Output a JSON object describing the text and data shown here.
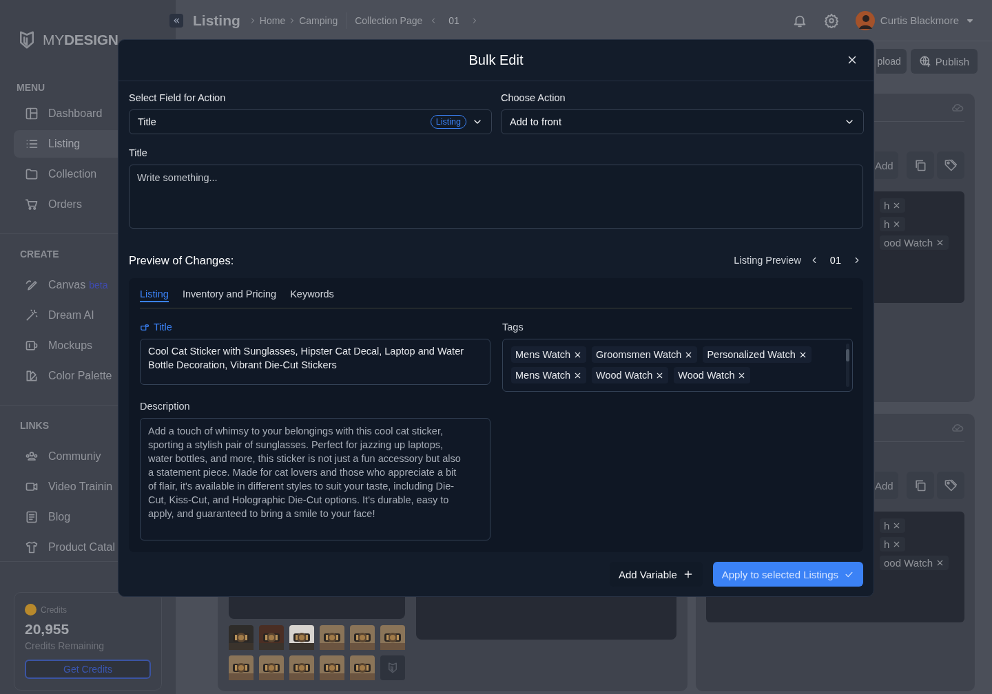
{
  "sidebar": {
    "logo": "MY**DESIGN**",
    "sections": [
      {
        "heading": "MENU",
        "items": [
          {
            "label": "Dashboard",
            "selected": false
          },
          {
            "label": "Listing",
            "selected": true
          },
          {
            "label": "Collection",
            "selected": false
          },
          {
            "label": "Orders",
            "selected": false
          }
        ]
      },
      {
        "heading": "CREATE",
        "items": [
          {
            "label": "Canvas",
            "badge": "beta",
            "selected": false
          },
          {
            "label": "Dream AI",
            "selected": false
          },
          {
            "label": "Mockups",
            "selected": false
          },
          {
            "label": "Color Palette",
            "selected": false
          }
        ]
      },
      {
        "heading": "LINKS",
        "items": [
          {
            "label": "Communiy",
            "selected": false
          },
          {
            "label": "Video Trainin",
            "selected": false
          },
          {
            "label": "Blog",
            "selected": false
          },
          {
            "label": "Product Catal",
            "selected": false
          }
        ]
      }
    ],
    "credits": {
      "label": "Credits",
      "amount": "20,955",
      "caption": "Credits Remaining",
      "button": "Get Credits"
    }
  },
  "header": {
    "title": "Listing",
    "breadcrumbs": [
      "Home",
      "Camping"
    ],
    "page_label": "Collection Page",
    "page": "01",
    "user": "Curtis Blackmore"
  },
  "background": {
    "toolbar_buttons": [
      "pload",
      "Publish"
    ],
    "cards": [
      {
        "button": "Add",
        "tags": [
          "h",
          "h",
          "ood Watch"
        ]
      },
      {
        "button": "Add",
        "tags": [
          "h",
          "h",
          "ood Watch"
        ]
      }
    ]
  },
  "modal": {
    "title": "Bulk Edit",
    "field_label": "Select Field for Action",
    "field_value": "Title",
    "field_badge": "Listing",
    "action_label": "Choose Action",
    "action_value": "Add to front",
    "text_label": "Title",
    "placeholder": "Write something...",
    "preview": {
      "heading": "Preview of Changes:",
      "nav_label": "Listing Preview",
      "page": "01",
      "tabs": [
        {
          "label": "Listing",
          "selected": true
        },
        {
          "label": "Inventory and Pricing",
          "selected": false
        },
        {
          "label": "Keywords",
          "selected": false
        }
      ],
      "title_label": "Title",
      "title_value": "Cool Cat Sticker with Sunglasses, Hipster Cat Decal, Laptop and Water Bottle Decoration, Vibrant Die-Cut Stickers",
      "tags_label": "Tags",
      "tags": [
        "Mens Watch",
        "Groomsmen Watch",
        "Personalized Watch",
        "Mens Watch",
        "Wood Watch",
        "Wood Watch"
      ],
      "description_label": "Description",
      "description": "Add a touch of whimsy to your belongings with this cool cat sticker, sporting a stylish pair of sunglasses. Perfect for jazzing up laptops, water bottles, and more, this sticker is not just a fun accessory but also a statement piece. Made for cat lovers and those who appreciate a bit of flair, it's available in different styles to suit your taste, including Die-Cut, Kiss-Cut, and Holographic Die-Cut options. It's durable, easy to apply, and guaranteed to bring a smile to your face!"
    },
    "buttons": {
      "add_variable": "Add Variable",
      "apply": "Apply to selected Listings"
    }
  }
}
